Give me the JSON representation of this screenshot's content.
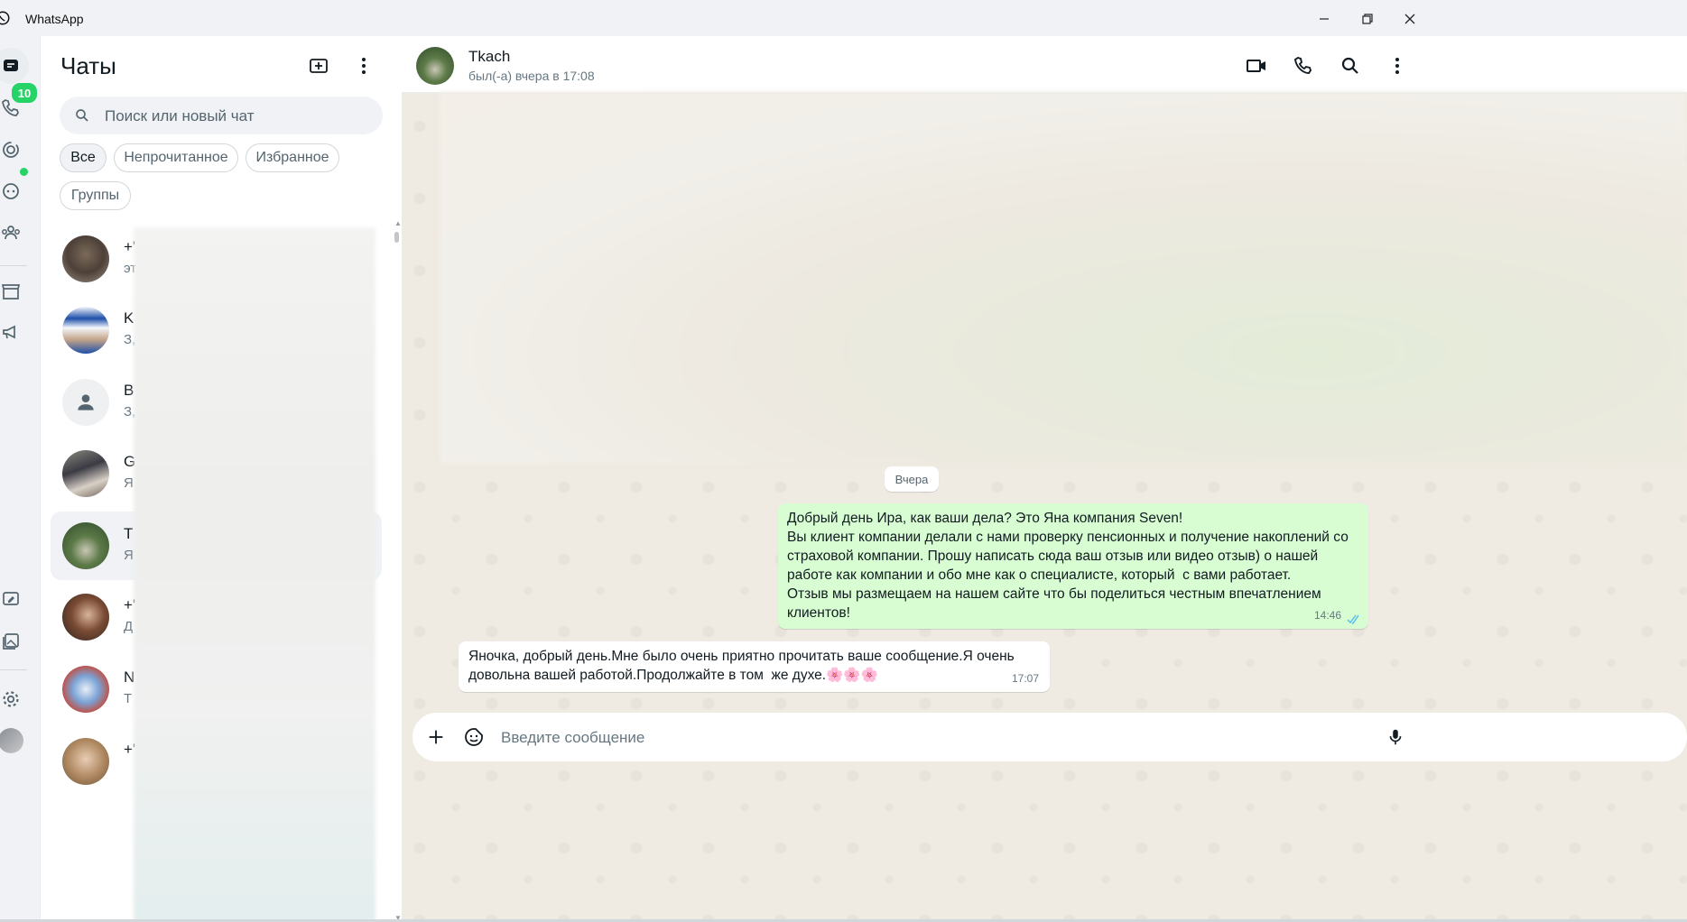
{
  "window": {
    "title": "WhatsApp"
  },
  "rail": {
    "unread_badge": "10"
  },
  "sidebar": {
    "title": "Чаты",
    "search_placeholder": "Поиск или новый чат",
    "filters": [
      "Все",
      "Непрочитанное",
      "Избранное",
      "Группы"
    ],
    "chats": [
      {
        "name": "+'",
        "preview": "эт"
      },
      {
        "name": "K",
        "preview": "З,"
      },
      {
        "name": "B",
        "preview": "З,"
      },
      {
        "name": "G",
        "preview": "Я"
      },
      {
        "name": "T",
        "preview": "Я"
      },
      {
        "name": "+'",
        "preview": "Д"
      },
      {
        "name": "N",
        "preview": "Т"
      },
      {
        "name": "+'",
        "preview": ""
      }
    ]
  },
  "conversation": {
    "contact_name": "Tkach",
    "contact_status": "был(-а) вчера в 17:08",
    "date_separator": "Вчера",
    "messages": [
      {
        "direction": "out",
        "text": "Добрый день Ира, как ваши дела? Это Яна компания Seven!\nВы клиент компании делали с нами проверку пенсионных и получение накоплений со страховой компании. Прошу написать сюда ваш отзыв или видео отзыв) о нашей работе как компании и обо мне как о специалисте, который  с вами работает.\nОтзыв мы размещаем на нашем сайте что бы поделиться честным впечатлением клиентов!",
        "time": "14:46"
      },
      {
        "direction": "in",
        "text": "Яночка, добрый день.Мне было очень приятно прочитать ваше сообщение.Я очень довольна вашей работой.Продолжайте в том  же духе.🌸🌸🌸",
        "time": "17:07"
      }
    ],
    "composer_placeholder": "Введите сообщение"
  },
  "colors": {
    "accent_green": "#25d366",
    "outgoing_bubble": "#d9fdd3",
    "read_ticks": "#53bdeb",
    "chat_background": "#efeae2"
  }
}
